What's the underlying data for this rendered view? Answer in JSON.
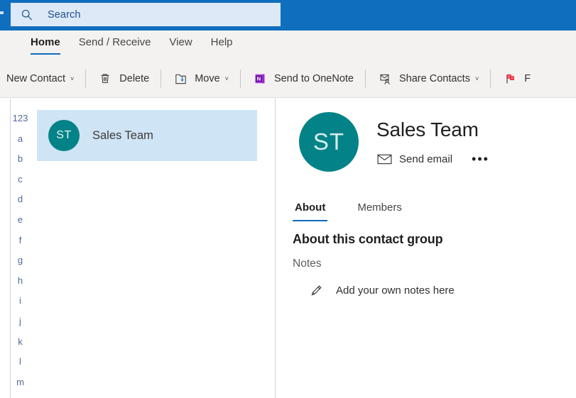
{
  "colors": {
    "titlebar_blue": "#106ebe",
    "search_field": "#dde9f7",
    "ribbon_bg": "#f3f2f1",
    "accent_blue": "#0f6cbd",
    "avatar_teal": "#038387",
    "selection_blue": "#cfe4f5",
    "flag_red": "#e81123",
    "onenote_purple": "#7719aa",
    "index_letter_blue": "#4f6a9c"
  },
  "search": {
    "icon": "search-icon",
    "value": "",
    "placeholder": "Search"
  },
  "ribbon": {
    "tabs": [
      {
        "label": "Home",
        "active": true
      },
      {
        "label": "Send / Receive",
        "active": false
      },
      {
        "label": "View",
        "active": false
      },
      {
        "label": "Help",
        "active": false
      }
    ],
    "commands": [
      {
        "label": "New Contact",
        "icon": "new-contact-icon",
        "caret": "˅",
        "has_icon": false
      },
      {
        "label": "Delete",
        "icon": "trash-icon",
        "caret": "",
        "has_icon": true
      },
      {
        "label": "Move",
        "icon": "move-folder-icon",
        "caret": "˅",
        "has_icon": true
      },
      {
        "label": "Send to OneNote",
        "icon": "onenote-icon",
        "caret": "",
        "has_icon": true
      },
      {
        "label": "Share Contacts",
        "icon": "share-contacts-icon",
        "caret": "˅",
        "has_icon": true
      },
      {
        "label": "F",
        "icon": "flag-icon",
        "caret": "",
        "has_icon": true
      }
    ]
  },
  "alpha_index": [
    "123",
    "a",
    "b",
    "c",
    "d",
    "e",
    "f",
    "g",
    "h",
    "i",
    "j",
    "k",
    "l",
    "m"
  ],
  "contact_list": {
    "items": [
      {
        "initials": "ST",
        "name": "Sales Team",
        "selected": true
      }
    ]
  },
  "detail": {
    "initials": "ST",
    "title": "Sales Team",
    "send_email_label": "Send email",
    "send_email_icon": "envelope-icon",
    "more_options": "•••",
    "tabs": [
      {
        "label": "About",
        "active": true
      },
      {
        "label": "Members",
        "active": false
      }
    ],
    "about": {
      "heading": "About this contact group",
      "notes_label": "Notes",
      "notes_placeholder": "Add your own notes here",
      "notes_icon": "pencil-icon"
    }
  }
}
